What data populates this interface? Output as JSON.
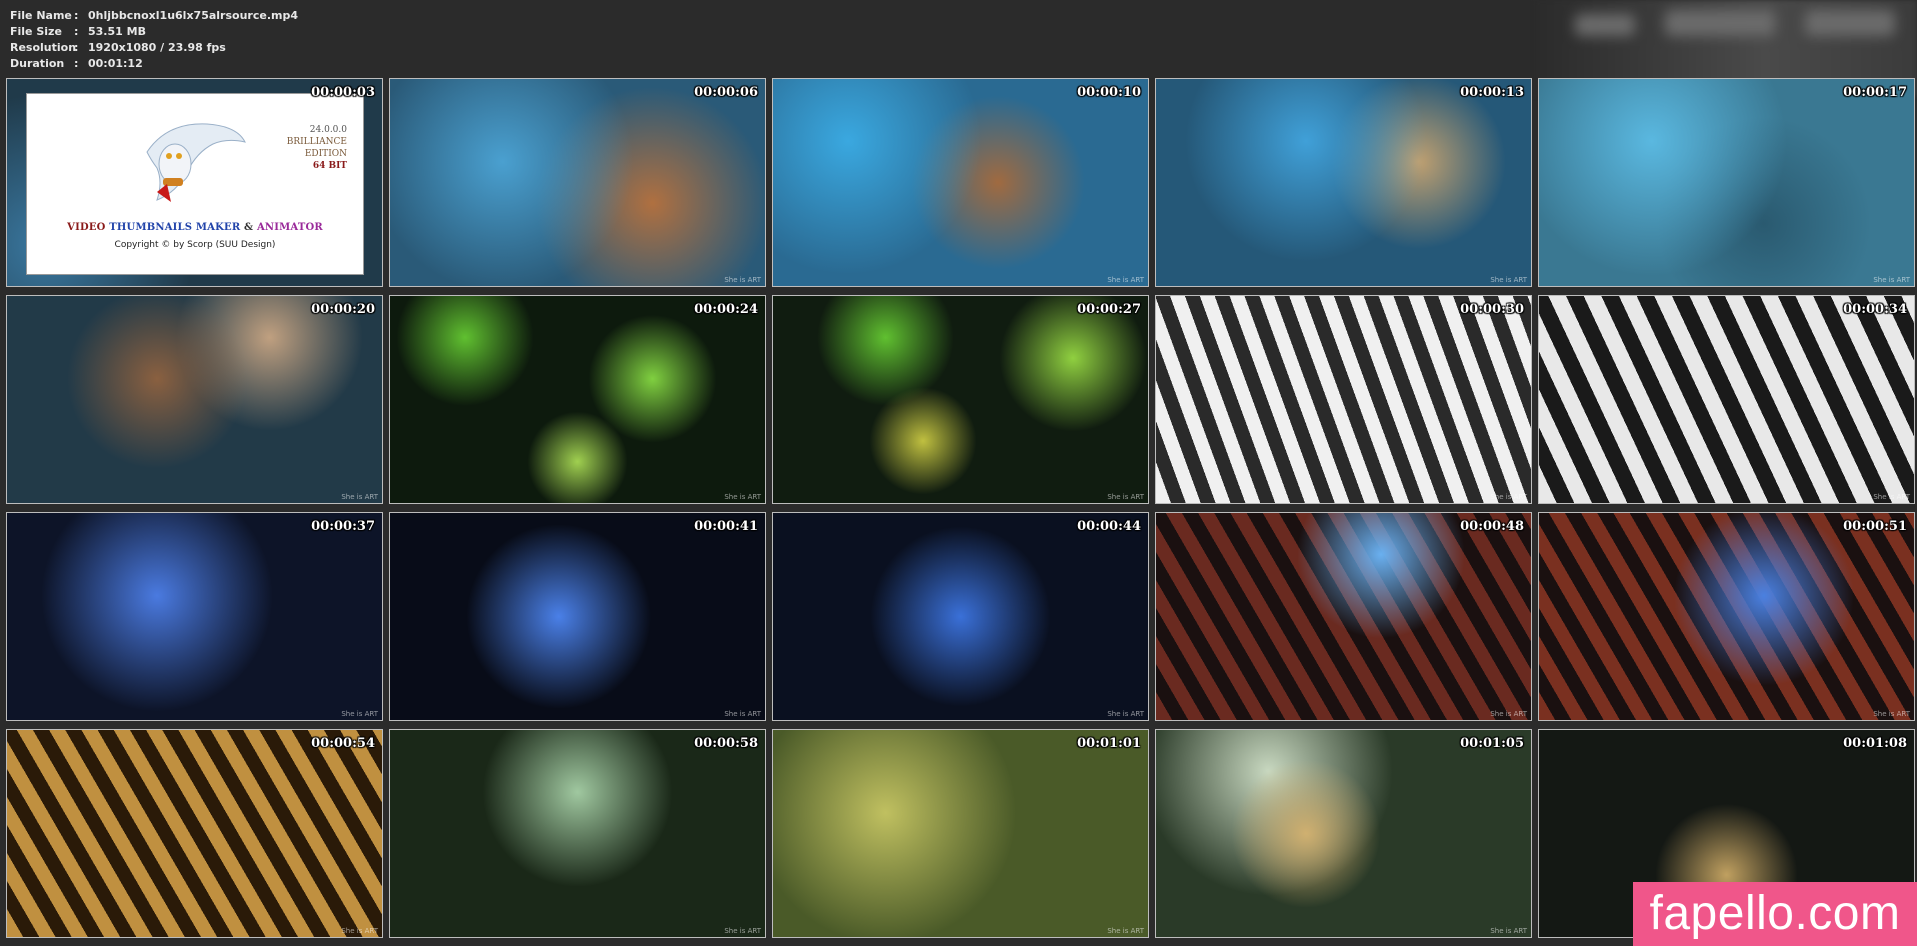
{
  "info": {
    "rows": [
      {
        "key": "File Name",
        "sep": ":",
        "value": "0hljbbcnoxl1u6lx75alrsource.mp4"
      },
      {
        "key": "File Size",
        "sep": ":",
        "value": "53.51 MB"
      },
      {
        "key": "Resolution",
        "sep": ":",
        "value": "1920x1080 / 23.98 fps"
      },
      {
        "key": "Duration",
        "sep": ":",
        "value": "00:01:12"
      }
    ]
  },
  "splash": {
    "version": "24.0.0.0",
    "edition_line1": "BRILLIANCE",
    "edition_line2": "EDITION",
    "bits": "64 BIT",
    "title_part1": "VIDEO",
    "title_part2": "THUMBNAILS MAKER",
    "title_part3": "&",
    "title_part4": "ANIMATOR",
    "copyright": "Copyright © by Scorp (SUU Design)"
  },
  "watermark": "She is ART",
  "thumbnails": [
    {
      "time": "00:00:03",
      "bg": "#203a4a"
    },
    {
      "time": "00:00:06",
      "bg": "#2a5a78"
    },
    {
      "time": "00:00:10",
      "bg": "#2a6a92"
    },
    {
      "time": "00:00:13",
      "bg": "#255878"
    },
    {
      "time": "00:00:17",
      "bg": "#3a7892"
    },
    {
      "time": "00:00:20",
      "bg": "#223a48"
    },
    {
      "time": "00:00:24",
      "bg": "#0d1a0d"
    },
    {
      "time": "00:00:27",
      "bg": "#101c10"
    },
    {
      "time": "00:00:30",
      "bg": "#8a8a8a"
    },
    {
      "time": "00:00:34",
      "bg": "#6a6a6a"
    },
    {
      "time": "00:00:37",
      "bg": "#0d1428"
    },
    {
      "time": "00:00:41",
      "bg": "#080c18"
    },
    {
      "time": "00:00:44",
      "bg": "#0a1020"
    },
    {
      "time": "00:00:48",
      "bg": "#3a2020"
    },
    {
      "time": "00:00:51",
      "bg": "#3a1a18"
    },
    {
      "time": "00:00:54",
      "bg": "#5a4418"
    },
    {
      "time": "00:00:58",
      "bg": "#1a2818"
    },
    {
      "time": "00:01:01",
      "bg": "#4a5a28"
    },
    {
      "time": "00:01:05",
      "bg": "#2a3a28"
    },
    {
      "time": "00:01:08",
      "bg": "#141814"
    }
  ],
  "badge": {
    "label": "fapello.com",
    "color": "#f0568a"
  }
}
